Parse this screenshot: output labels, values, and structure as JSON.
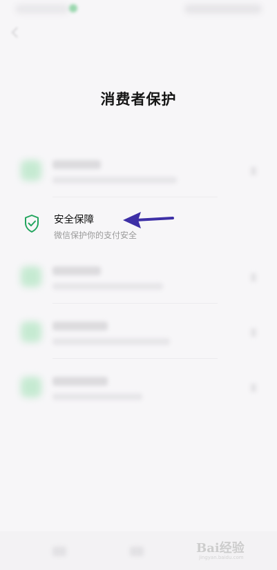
{
  "header": {
    "title": "消费者保护"
  },
  "list": {
    "active_item": {
      "title": "安全保障",
      "subtitle": "微信保护你的支付安全"
    }
  },
  "colors": {
    "shield_green": "#22a45d",
    "arrow_indigo": "#3d2fa6"
  },
  "icons": {
    "active_item_icon": "shield-check-icon",
    "annotation": "left-arrow-icon"
  },
  "watermark": {
    "text": "Bai经验",
    "sub": "jingyan.baidu.com"
  }
}
